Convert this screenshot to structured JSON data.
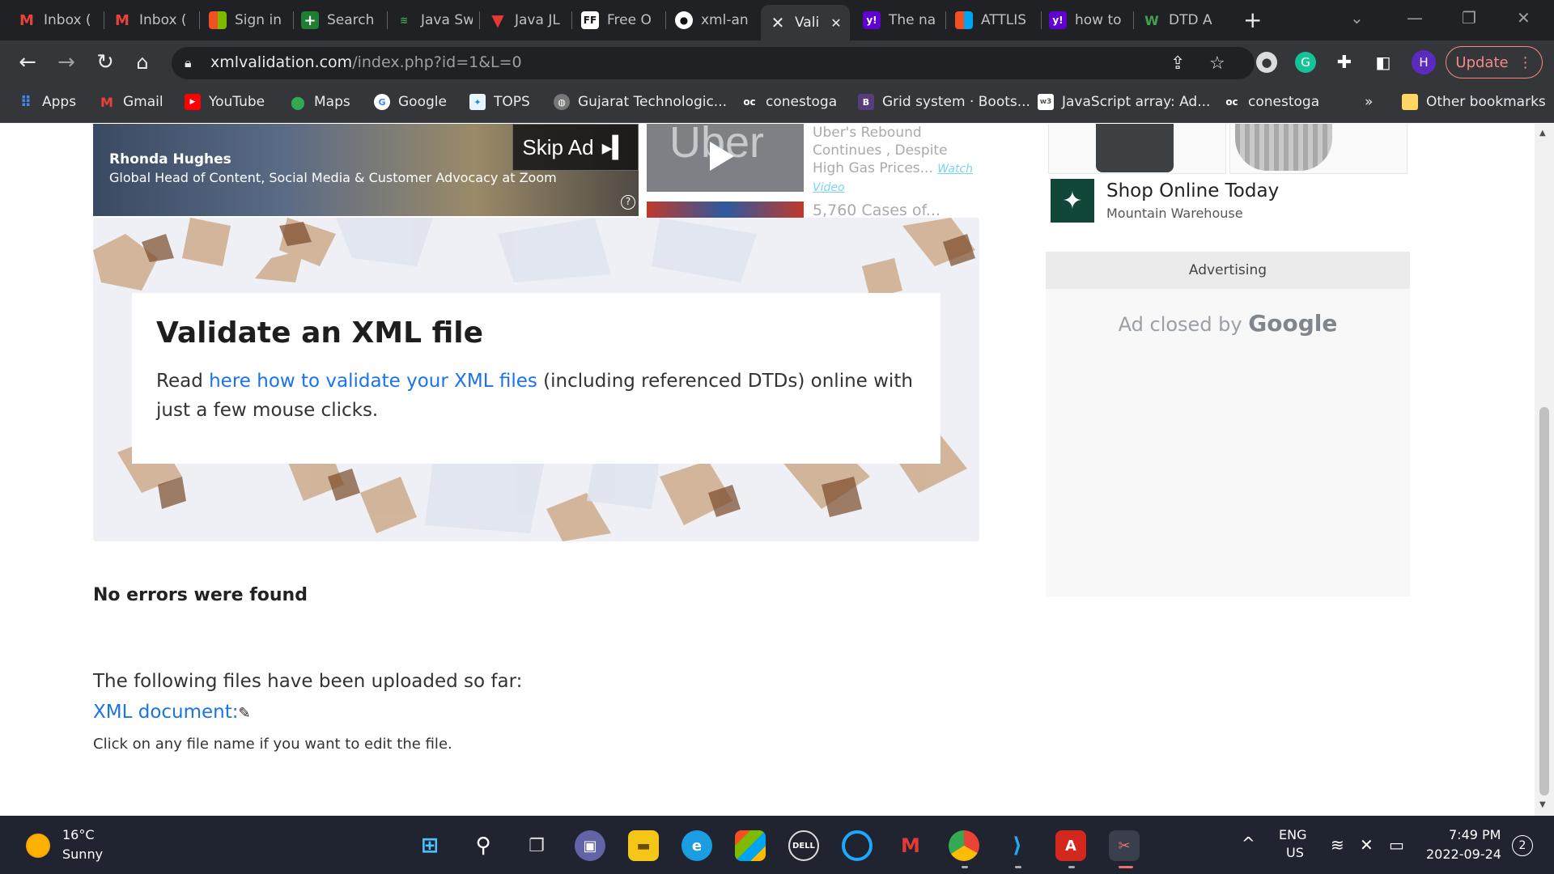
{
  "browser": {
    "tabs": [
      {
        "label": "Inbox (",
        "favicon": "gmail-icon"
      },
      {
        "label": "Inbox (",
        "favicon": "gmail-icon"
      },
      {
        "label": "Sign in",
        "favicon": "microsoft-icon"
      },
      {
        "label": "Search",
        "favicon": "plus-icon"
      },
      {
        "label": "Java Sw",
        "favicon": "java-icon"
      },
      {
        "label": "Java JL",
        "favicon": "java-icon"
      },
      {
        "label": "Free O",
        "favicon": "ff-icon"
      },
      {
        "label": "xml-an",
        "favicon": "github-icon"
      },
      {
        "label": "Vali",
        "favicon": "xml-icon"
      },
      {
        "label": "The na",
        "favicon": "yahoo-icon"
      },
      {
        "label": "ATTLIS",
        "favicon": "microsoft-icon"
      },
      {
        "label": "how to",
        "favicon": "yahoo-icon"
      },
      {
        "label": "DTD A",
        "favicon": "w-icon"
      }
    ],
    "url_host": "xmlvalidation.com",
    "url_path": "/index.php?id=1&L=0",
    "profile_initial": "H",
    "update_label": "Update",
    "bookmarks": [
      {
        "label": "Apps",
        "icon": "apps-grid-icon"
      },
      {
        "label": "Gmail",
        "icon": "gmail-icon"
      },
      {
        "label": "YouTube",
        "icon": "youtube-icon"
      },
      {
        "label": "Maps",
        "icon": "maps-icon"
      },
      {
        "label": "Google",
        "icon": "google-icon"
      },
      {
        "label": "TOPS",
        "icon": "tops-icon"
      },
      {
        "label": "Gujarat Technologic...",
        "icon": "globe-icon"
      },
      {
        "label": "conestoga",
        "icon": "oc-icon"
      },
      {
        "label": "Grid system · Boots...",
        "icon": "bootstrap-icon"
      },
      {
        "label": "JavaScript array: Ad...",
        "icon": "w3-icon"
      },
      {
        "label": "conestoga",
        "icon": "oc-icon"
      }
    ],
    "more_bookmarks": "»",
    "other_bookmarks": "Other bookmarks"
  },
  "page": {
    "video_ad": {
      "person": "Rhonda Hughes",
      "title": "Global Head of Content, Social Media & Customer Advocacy at Zoom",
      "skip_label": "Skip Ad",
      "uber_logo": "Uber",
      "news1": "Uber's Rebound Continues , Despite High Gas Prices...",
      "watch": "Watch Video",
      "news2": "5,760 Cases of..."
    },
    "hero": {
      "title": "Validate an XML file",
      "text_before": "Read ",
      "link_text": "here how to validate your XML files",
      "text_after": " (including referenced DTDs) online with just a few mouse clicks."
    },
    "result": "No errors were found",
    "uploaded_label": "The following files have been uploaded so far:",
    "xml_link": "XML document:",
    "edit_hint": "Click on any file name if you want to edit the file.",
    "sidebar": {
      "shop_title": "Shop Online Today",
      "shop_sub": "Mountain Warehouse",
      "advertising": "Advertising",
      "ad_closed_prefix": "Ad closed by ",
      "ad_closed_brand": "Google"
    }
  },
  "taskbar": {
    "temp": "16°C",
    "weather": "Sunny",
    "lang1": "ENG",
    "lang2": "US",
    "time": "7:49 PM",
    "date": "2022-09-24",
    "notifications": "2"
  }
}
